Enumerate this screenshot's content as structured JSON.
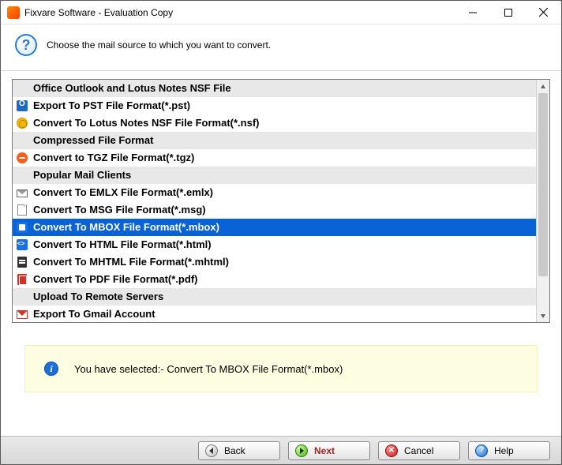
{
  "window": {
    "title": "Fixvare Software - Evaluation Copy"
  },
  "header": {
    "text": "Choose the mail source to which you want to convert."
  },
  "list": {
    "rows": [
      {
        "type": "header",
        "label": "Office Outlook and Lotus Notes NSF File",
        "icon": "none"
      },
      {
        "type": "item",
        "label": "Export To PST File Format(*.pst)",
        "icon": "outlook"
      },
      {
        "type": "item",
        "label": "Convert To Lotus Notes NSF File Format(*.nsf)",
        "icon": "nsf"
      },
      {
        "type": "header",
        "label": "Compressed File Format",
        "icon": "none"
      },
      {
        "type": "item",
        "label": "Convert to TGZ File Format(*.tgz)",
        "icon": "tgz"
      },
      {
        "type": "header",
        "label": "Popular Mail Clients",
        "icon": "none"
      },
      {
        "type": "item",
        "label": "Convert To EMLX File Format(*.emlx)",
        "icon": "env"
      },
      {
        "type": "item",
        "label": "Convert To MSG File Format(*.msg)",
        "icon": "msg"
      },
      {
        "type": "item",
        "label": "Convert To MBOX File Format(*.mbox)",
        "icon": "mbox",
        "selected": true
      },
      {
        "type": "item",
        "label": "Convert To HTML File Format(*.html)",
        "icon": "html"
      },
      {
        "type": "item",
        "label": "Convert To MHTML File Format(*.mhtml)",
        "icon": "mhtml"
      },
      {
        "type": "item",
        "label": "Convert To PDF File Format(*.pdf)",
        "icon": "pdf"
      },
      {
        "type": "header",
        "label": "Upload To Remote Servers",
        "icon": "none"
      },
      {
        "type": "item",
        "label": "Export To Gmail Account",
        "icon": "gmail"
      }
    ]
  },
  "info": {
    "text": "You have selected:- Convert To MBOX File Format(*.mbox)"
  },
  "footer": {
    "back": "Back",
    "next": "Next",
    "cancel": "Cancel",
    "help": "Help"
  }
}
